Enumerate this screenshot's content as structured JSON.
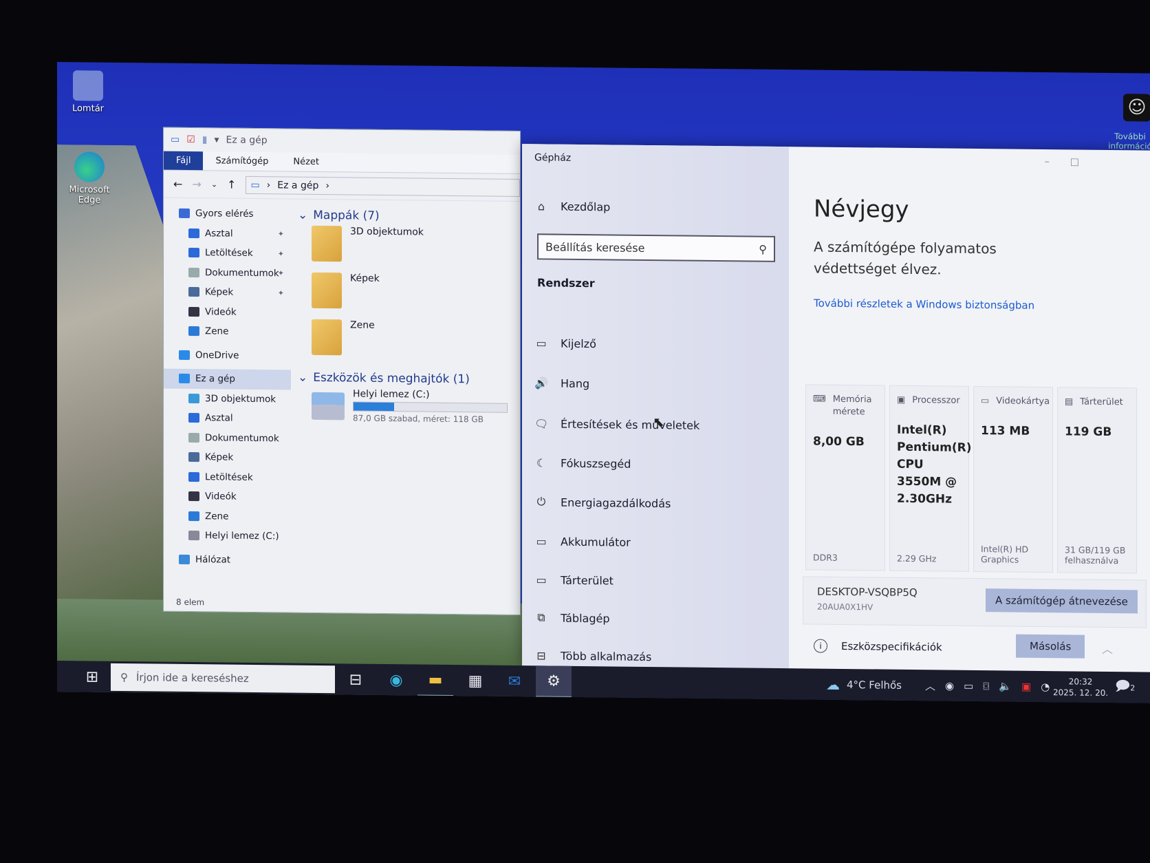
{
  "desktop": {
    "icons": [
      {
        "label": "Lomtár"
      },
      {
        "label": "Microsoft Edge"
      }
    ],
    "corner_label": "További információ"
  },
  "explorer": {
    "title": "Ez a gép",
    "ribbon_tabs": [
      "Fájl",
      "Számítógép",
      "Nézet"
    ],
    "address": "Ez a gép",
    "nav": [
      {
        "label": "Gyors elérés",
        "type": "sec",
        "color": "#3a6ad8"
      },
      {
        "label": "Asztal",
        "pinned": true,
        "color": "#2b6ad8"
      },
      {
        "label": "Letöltések",
        "pinned": true,
        "color": "#2b6ad8"
      },
      {
        "label": "Dokumentumok",
        "pinned": true,
        "color": "#9aa"
      },
      {
        "label": "Képek",
        "pinned": true,
        "color": "#4a6a9a"
      },
      {
        "label": "Videók",
        "color": "#334"
      },
      {
        "label": "Zene",
        "color": "#2b7ad8"
      },
      {
        "label": "OneDrive",
        "type": "sec",
        "color": "#2b8ae8"
      },
      {
        "label": "Ez a gép",
        "type": "sec",
        "selected": true,
        "color": "#2b8ae8"
      },
      {
        "label": "3D objektumok",
        "type": "sub",
        "color": "#3a9ad8"
      },
      {
        "label": "Asztal",
        "type": "sub",
        "color": "#2b6ad8"
      },
      {
        "label": "Dokumentumok",
        "type": "sub",
        "color": "#9aa"
      },
      {
        "label": "Képek",
        "type": "sub",
        "color": "#4a6a9a"
      },
      {
        "label": "Letöltések",
        "type": "sub",
        "color": "#2b6ad8"
      },
      {
        "label": "Videók",
        "type": "sub",
        "color": "#334"
      },
      {
        "label": "Zene",
        "type": "sub",
        "color": "#2b7ad8"
      },
      {
        "label": "Helyi lemez (C:)",
        "type": "sub",
        "color": "#889"
      },
      {
        "label": "Hálózat",
        "type": "sec",
        "color": "#3a8ad8"
      }
    ],
    "folders_header": "Mappák (7)",
    "folders": [
      "3D objektumok",
      "Képek",
      "Zene"
    ],
    "drives_header": "Eszközök és meghajtók (1)",
    "drive": {
      "name": "Helyi lemez (C:)",
      "info": "87,0 GB szabad, méret: 118 GB",
      "used_fraction": 0.263
    },
    "status": "8 elem"
  },
  "settings": {
    "title": "Gépház",
    "home": "Kezdőlap",
    "search_placeholder": "Beállítás keresése",
    "section": "Rendszer",
    "items": [
      {
        "label": "Kijelző",
        "icon": "▭"
      },
      {
        "label": "Hang",
        "icon": "🔊"
      },
      {
        "label": "Értesítések és műveletek",
        "icon": "🗨"
      },
      {
        "label": "Fókuszsegéd",
        "icon": "☾"
      },
      {
        "label": "Energiagazdálkodás",
        "icon": "⏻"
      },
      {
        "label": "Akkumulátor",
        "icon": "▭"
      },
      {
        "label": "Tárterület",
        "icon": "▭"
      },
      {
        "label": "Táblagép",
        "icon": "⧉"
      },
      {
        "label": "Több alkalmazás",
        "icon": "⊟"
      }
    ],
    "page_title": "Névjegy",
    "protection": "A számítógépe folyamatos védettséget élvez.",
    "link": "További részletek a Windows biztonságban",
    "cards": [
      {
        "title": "Memória mérete",
        "value": "8,00 GB",
        "footer": "DDR3",
        "icon": "⌨"
      },
      {
        "title": "Processzor",
        "value": "Intel(R) Pentium(R) CPU 3550M @ 2.30GHz",
        "footer": "2.29 GHz",
        "icon": "▣"
      },
      {
        "title": "Videokártya",
        "value": "113 MB",
        "footer": "Intel(R) HD Graphics",
        "icon": "▭"
      },
      {
        "title": "Tárterület",
        "value": "119 GB",
        "footer": "31 GB/119 GB felhasználva",
        "icon": "▤"
      }
    ],
    "device_name": "DESKTOP-VSQBP5Q",
    "device_model": "20AUA0X1HV",
    "rename_button": "A számítógép átnevezése",
    "specs_label": "Eszközspecifikációk",
    "copy_button": "Másolás"
  },
  "taskbar": {
    "search_placeholder": "Írjon ide a kereséshez",
    "weather": "4°C  Felhős",
    "time": "20:32",
    "date": "2025. 12. 20.",
    "notifications": "2"
  }
}
